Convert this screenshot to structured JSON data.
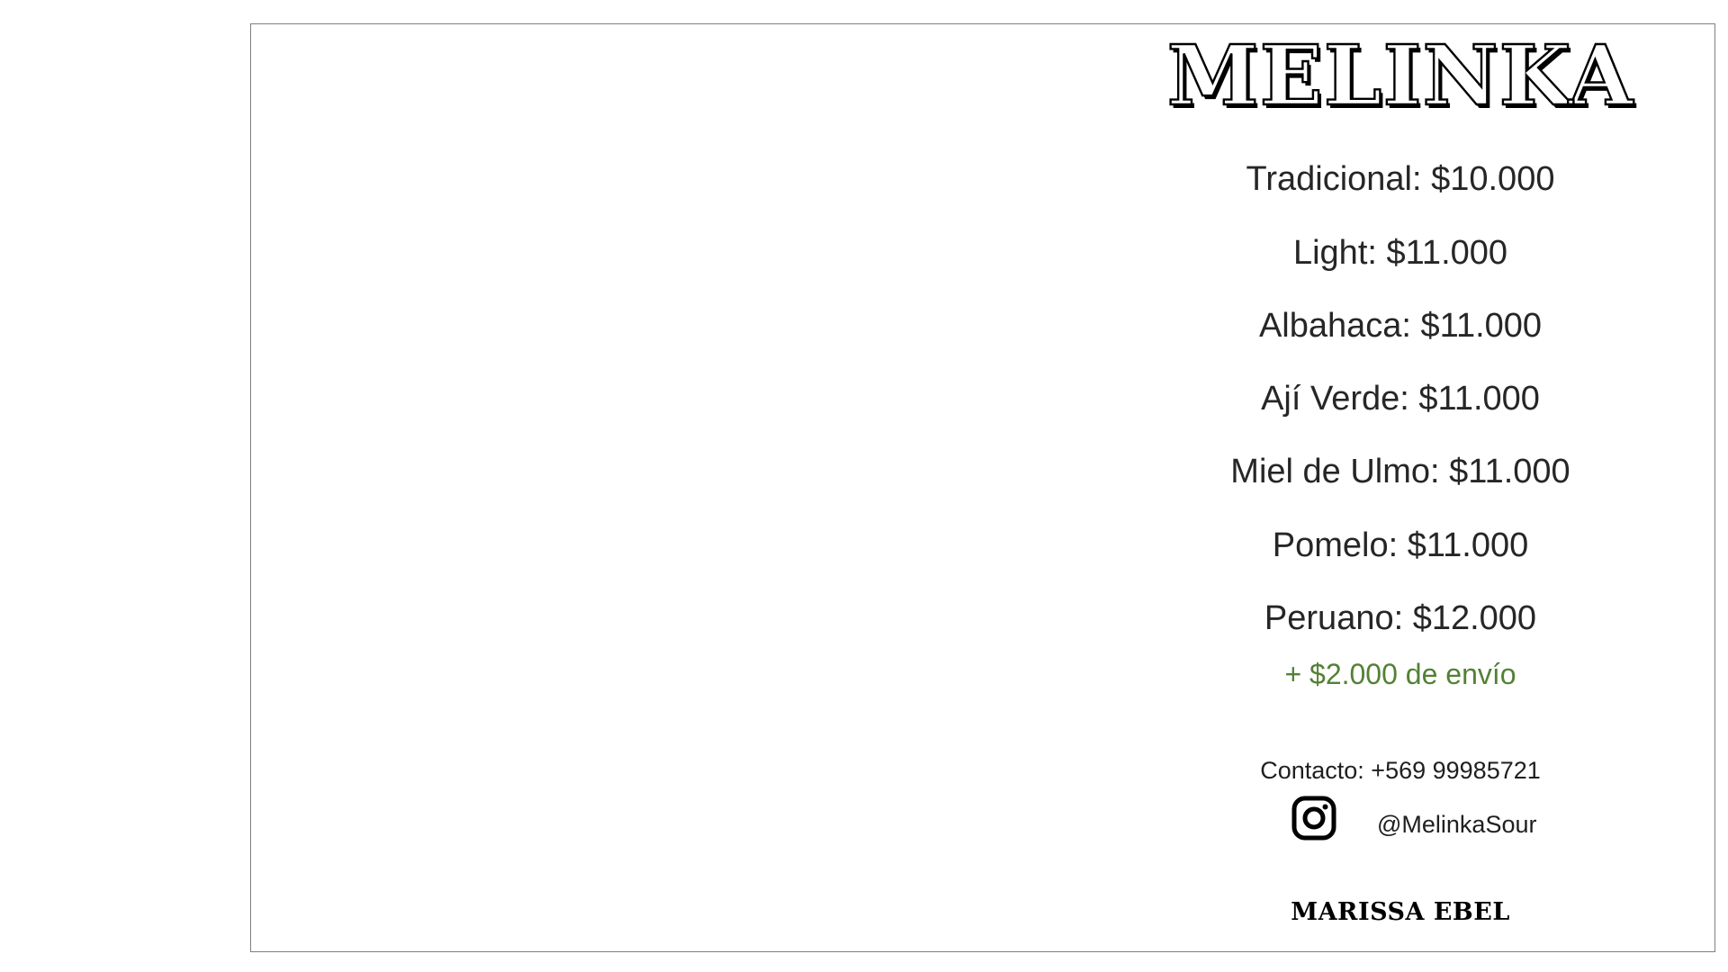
{
  "brand": "MELINKA",
  "prices": [
    "Tradicional: $10.000",
    "Light: $11.000",
    "Albahaca: $11.000",
    "Ají Verde: $11.000",
    "Miel de Ulmo: $11.000",
    "Pomelo: $11.000",
    "Peruano: $12.000"
  ],
  "shipping": "+ $2.000 de envío",
  "contact": "Contacto: +569 99985721",
  "instagram": {
    "icon": "instagram-icon",
    "handle": "@MelinkaSour"
  },
  "signature": "MARISSA EBEL",
  "colors": {
    "shipping": "#538135",
    "border": "#7f7f7f"
  }
}
